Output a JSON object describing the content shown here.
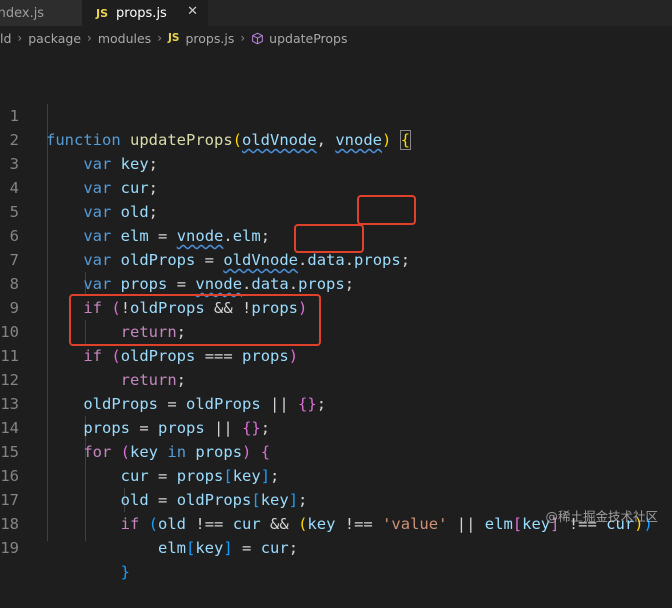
{
  "tabs": [
    {
      "label": "index.js"
    },
    {
      "label": "props.js",
      "badge": "JS",
      "close": "✕"
    }
  ],
  "breadcrumb": {
    "items": [
      "ld",
      "package",
      "modules"
    ],
    "file_badge": "JS",
    "file": "props.js",
    "symbol": "updateProps"
  },
  "editor": {
    "lines": [
      {
        "n": "1"
      },
      {
        "n": "2"
      },
      {
        "n": "3"
      },
      {
        "n": "4"
      },
      {
        "n": "5"
      },
      {
        "n": "6"
      },
      {
        "n": "7"
      },
      {
        "n": "8"
      },
      {
        "n": "9"
      },
      {
        "n": "10"
      },
      {
        "n": "11"
      },
      {
        "n": "12"
      },
      {
        "n": "13"
      },
      {
        "n": "14"
      },
      {
        "n": "15"
      },
      {
        "n": "16"
      },
      {
        "n": "17"
      },
      {
        "n": "18"
      },
      {
        "n": "19"
      }
    ]
  },
  "watermark": "@稀土掘金技术社区",
  "colors": {
    "background": "#1e1e1e",
    "keyword": "#569cd6",
    "function": "#dcdcaa",
    "variable": "#9cdcfe",
    "control": "#c586c0",
    "string": "#ce9178",
    "highlight_box": "#e0412b"
  }
}
